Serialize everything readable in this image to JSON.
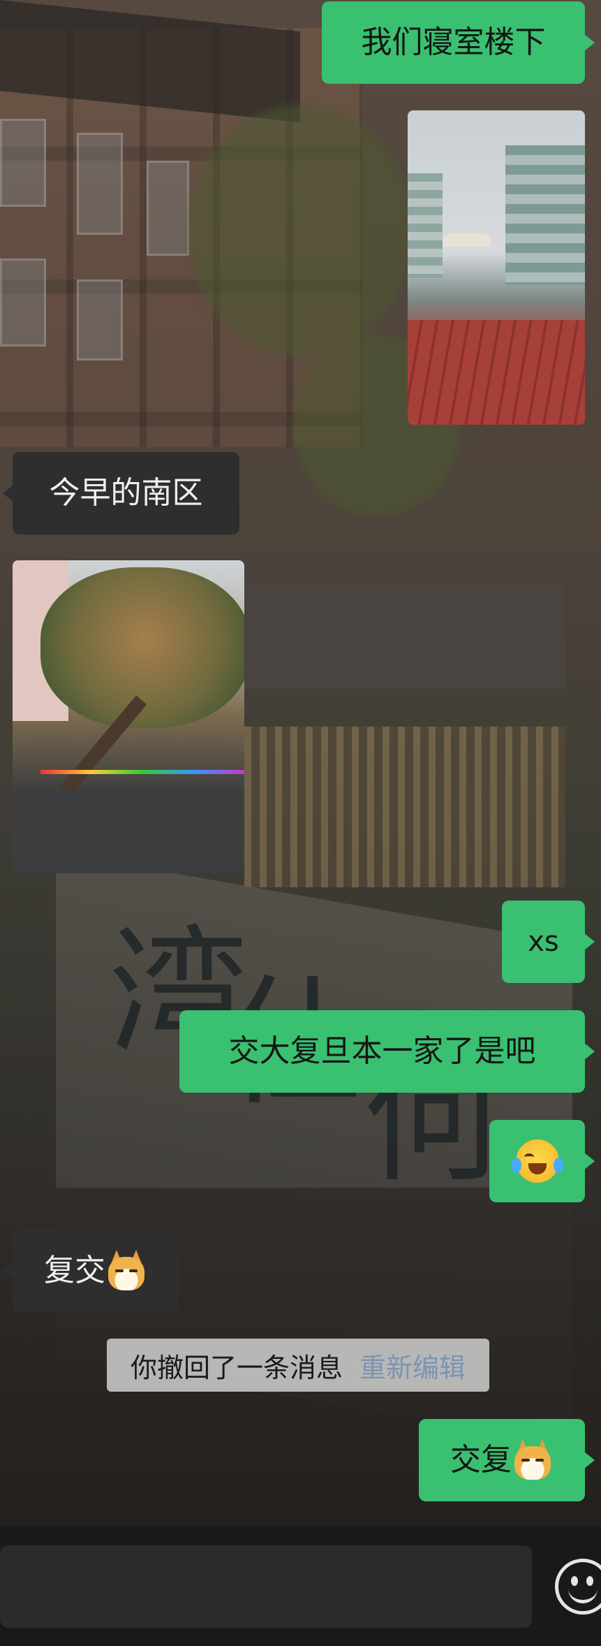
{
  "messages": [
    {
      "side": "out",
      "type": "text",
      "text": "我们寝室楼下"
    },
    {
      "side": "out",
      "type": "image",
      "image": "dorm-courtyard-photo"
    },
    {
      "side": "in",
      "type": "text",
      "text": "今早的南区"
    },
    {
      "side": "in",
      "type": "image",
      "image": "fallen-tree-photo"
    },
    {
      "side": "out",
      "type": "text",
      "text": "xs"
    },
    {
      "side": "out",
      "type": "text",
      "text": "交大复旦本一家了是吧"
    },
    {
      "side": "out",
      "type": "emoji",
      "emoji": "crying-laughing-emoji"
    },
    {
      "side": "in",
      "type": "text",
      "text": "复交",
      "emoji": "doge-emoji"
    },
    {
      "side": "out",
      "type": "text",
      "text": "交复",
      "emoji": "doge-emoji"
    }
  ],
  "system": {
    "recall_text": "你撤回了一条消息",
    "reedit_label": "重新编辑"
  },
  "input_bar": {
    "emoji_button_icon": "smiley-face-icon"
  },
  "colors": {
    "outgoing_bubble": "#39c071",
    "incoming_bubble": "#2e2e2e",
    "reedit_link": "#7c93b3"
  }
}
